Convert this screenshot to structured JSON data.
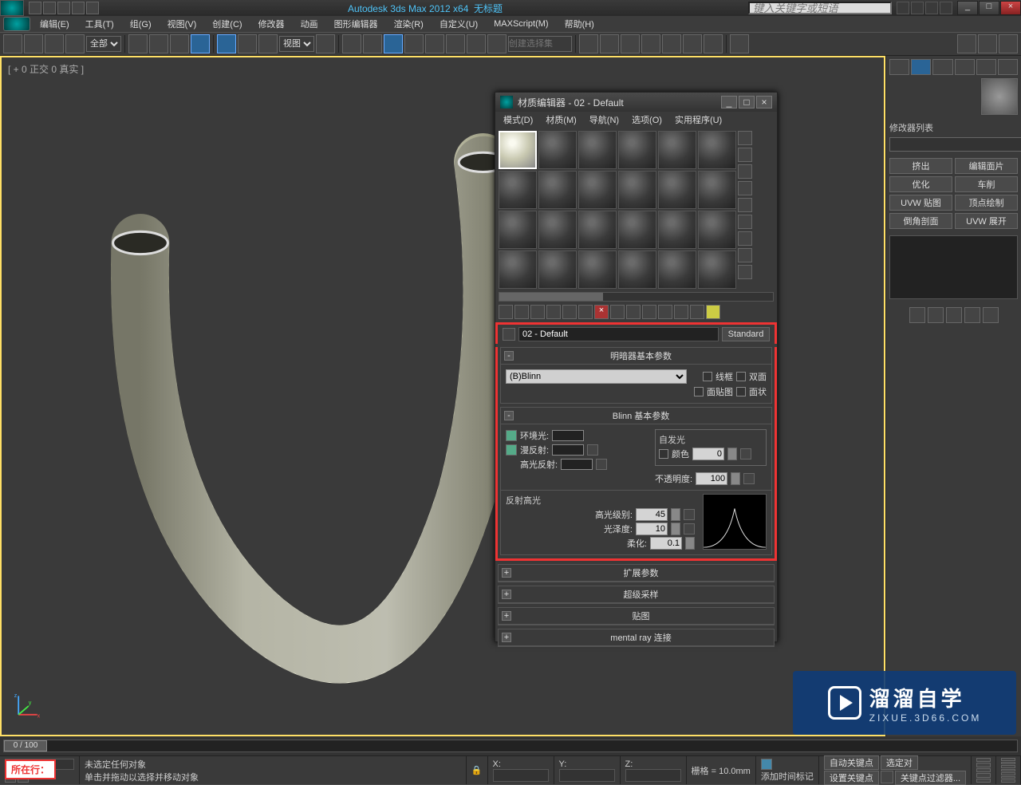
{
  "title": {
    "app": "Autodesk 3ds Max 2012 x64",
    "doc": "无标题",
    "search_ph": "键入关键字或短语"
  },
  "menus": [
    "编辑(E)",
    "工具(T)",
    "组(G)",
    "视图(V)",
    "创建(C)",
    "修改器",
    "动画",
    "图形编辑器",
    "渲染(R)",
    "自定义(U)",
    "MAXScript(M)",
    "帮助(H)"
  ],
  "toolbar": {
    "filter": "全部",
    "refcoord": "视图",
    "selset_ph": "创建选择集"
  },
  "viewport": {
    "label": "[ + 0 正交 0 真实 ]"
  },
  "rightPanel": {
    "modlist_label": "修改器列表",
    "buttons": [
      "挤出",
      "编辑面片",
      "优化",
      "车削",
      "UVW 贴图",
      "顶点绘制",
      "倒角剖面",
      "UVW 展开"
    ]
  },
  "materialEditor": {
    "title": "材质编辑器 - 02 - Default",
    "menus": [
      "模式(D)",
      "材质(M)",
      "导航(N)",
      "选项(O)",
      "实用程序(U)"
    ],
    "matName": "02 - Default",
    "typeBtn": "Standard",
    "shader_rollout": "明暗器基本参数",
    "shader_sel": "(B)Blinn",
    "chk_wire": "线框",
    "chk_2side": "双面",
    "chk_facemap": "面贴图",
    "chk_faceted": "面状",
    "blinn_rollout": "Blinn 基本参数",
    "ambient": "环境光:",
    "diffuse": "漫反射:",
    "specular": "高光反射:",
    "selfillum_grp": "自发光",
    "selfillum_color": "颜色",
    "selfillum_val": "0",
    "opacity_lbl": "不透明度:",
    "opacity_val": "100",
    "spec_grp": "反射高光",
    "spec_level": "高光级别:",
    "spec_level_val": "45",
    "gloss": "光泽度:",
    "gloss_val": "10",
    "soften": "柔化:",
    "soften_val": "0.1",
    "more_rollouts": [
      "扩展参数",
      "超级采样",
      "贴图",
      "mental ray 连接"
    ]
  },
  "timeline": {
    "range": "0 / 100"
  },
  "status": {
    "none_sel": "未选定任何对象",
    "hint": "单击并拖动以选择并移动对象",
    "lock_icon": "🔒",
    "x": "X:",
    "y": "Y:",
    "z": "Z:",
    "grid": "栅格 = 10.0mm",
    "addtime": "添加时间标记",
    "autokey": "自动关键点",
    "selset": "选定对",
    "setkey": "设置关键点",
    "keyfilter": "关键点过滤器..."
  },
  "watermark": {
    "t1": "溜溜自学",
    "t2": "ZIXUE.3D66.COM"
  },
  "cmd": "所在行："
}
